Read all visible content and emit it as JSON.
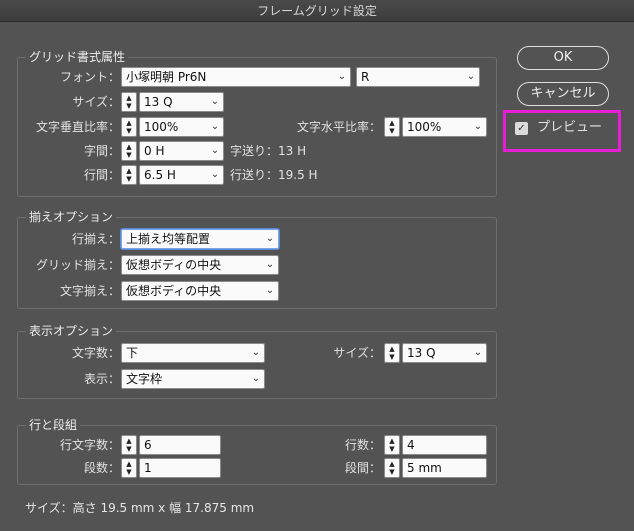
{
  "window": {
    "title": "フレームグリッド設定"
  },
  "grid": {
    "title": "グリッド書式属性",
    "font_label": "フォント：",
    "font_family": "小塚明朝 Pr6N",
    "font_style": "R",
    "size_label": "サイズ：",
    "size_value": "13 Q",
    "vscale_label": "文字垂直比率：",
    "vscale_value": "100%",
    "hscale_label": "文字水平比率：",
    "hscale_value": "100%",
    "char_aki_label": "字間：",
    "char_aki_value": "0 H",
    "char_feed": "字送り：13 H",
    "line_aki_label": "行間：",
    "line_aki_value": "6.5 H",
    "line_feed": "行送り：19.5 H"
  },
  "align": {
    "title": "揃えオプション",
    "line_label": "行揃え：",
    "line_value": "上揃え均等配置",
    "grid_label": "グリッド揃え：",
    "grid_value": "仮想ボディの中央",
    "char_label": "文字揃え：",
    "char_value": "仮想ボディの中央"
  },
  "display": {
    "title": "表示オプション",
    "count_label": "文字数：",
    "count_value": "下",
    "size_label": "サイズ：",
    "size_value": "13 Q",
    "view_label": "表示：",
    "view_value": "文字枠"
  },
  "columns": {
    "title": "行と段組",
    "chars_label": "行文字数：",
    "chars_value": "6",
    "lines_label": "行数：",
    "lines_value": "4",
    "cols_label": "段数：",
    "cols_value": "1",
    "gutter_label": "段間：",
    "gutter_value": "5 mm"
  },
  "buttons": {
    "ok": "OK",
    "cancel": "キャンセル",
    "preview": "プレビュー",
    "preview_checked": true
  },
  "footer": "サイズ：高さ 19.5 mm x 幅 17.875 mm",
  "colors": {
    "highlight": "#e81ed6",
    "background": "#535353"
  }
}
